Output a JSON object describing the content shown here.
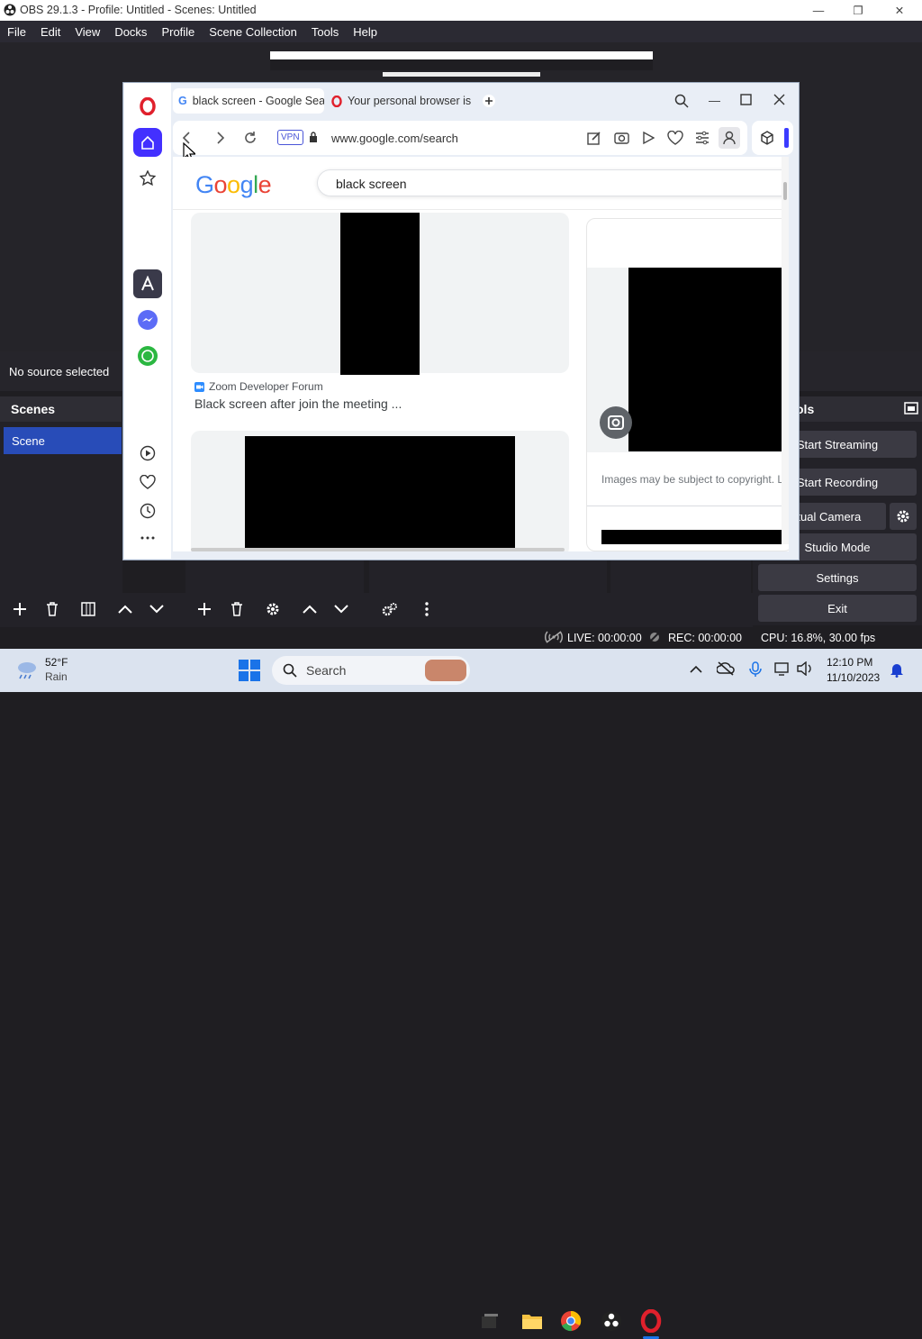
{
  "obs": {
    "title": "OBS 29.1.3 - Profile: Untitled - Scenes: Untitled",
    "menu": [
      "File",
      "Edit",
      "View",
      "Docks",
      "Profile",
      "Scene Collection",
      "Tools",
      "Help"
    ],
    "no_source": "No source selected",
    "scenes_title": "Scenes",
    "scene_item": "Scene",
    "controls_title_partial": "ols",
    "controls": {
      "start_streaming": "Start Streaming",
      "start_recording": "Start Recording",
      "virtual_camera": "Virtual Camera",
      "studio_mode": "Studio Mode",
      "settings": "Settings",
      "exit": "Exit"
    },
    "status": {
      "live": "LIVE: 00:00:00",
      "rec": "REC: 00:00:00",
      "cpu": "CPU: 16.8%, 30.00 fps"
    }
  },
  "browser": {
    "tabs": [
      {
        "label": "black screen - Google Sea",
        "active": true
      },
      {
        "label": "Your personal browser is",
        "active": false
      }
    ],
    "vpn": "VPN",
    "url": "www.google.com/search",
    "google_logo": "Google",
    "search_query": "black screen",
    "result": {
      "source": "Zoom Developer Forum",
      "title": "Black screen after join the meeting ..."
    },
    "copyright": "Images may be subject to copyright. L"
  },
  "taskbar": {
    "weather_temp": "52°F",
    "weather_desc": "Rain",
    "search_label": "Search",
    "time": "12:10 PM",
    "date": "11/10/2023"
  },
  "colors": {
    "obs_accent": "#284cb8",
    "opera_red": "#e0202c",
    "opera_blue": "#3b3bff"
  }
}
